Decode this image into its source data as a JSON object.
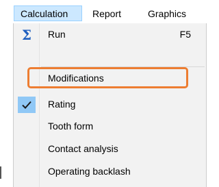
{
  "menubar": {
    "items": [
      {
        "label": "Calculation",
        "active": true
      },
      {
        "label": "Report",
        "active": false
      },
      {
        "label": "Graphics",
        "active": false
      }
    ]
  },
  "dropdown": {
    "items": [
      {
        "label": "Run",
        "shortcut": "F5",
        "icon": "sigma-icon",
        "icon_glyph": "Σ"
      },
      {
        "label": "Modifications",
        "highlighted": true
      },
      {
        "label": "Rating",
        "checked": true,
        "icon": "checkmark-icon"
      },
      {
        "label": "Tooth form"
      },
      {
        "label": "Contact analysis"
      },
      {
        "label": "Operating backlash"
      }
    ]
  },
  "colors": {
    "menubar_active_bg": "#cce8ff",
    "dropdown_bg": "#f2f2f2",
    "checked_bg": "#90c8f6",
    "sigma": "#1f5fbf",
    "annotation_frame": "#ed7d31"
  }
}
